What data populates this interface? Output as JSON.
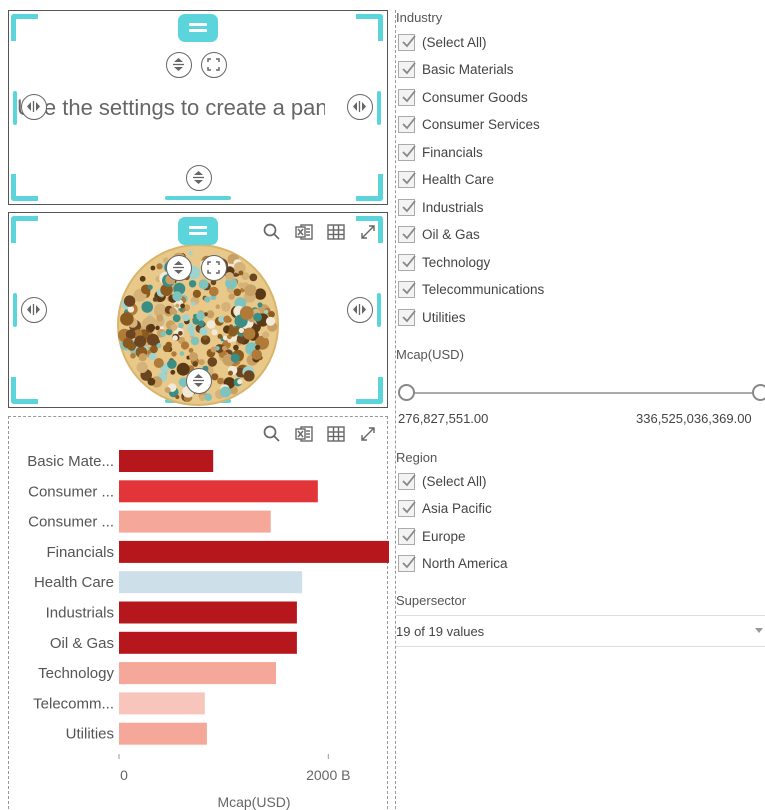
{
  "text_panel": {
    "placeholder": "Use the settings to create a panel"
  },
  "industry_filter": {
    "title": "Industry",
    "items": [
      {
        "label": "(Select All)",
        "checked": true
      },
      {
        "label": "Basic Materials",
        "checked": true
      },
      {
        "label": "Consumer Goods",
        "checked": true
      },
      {
        "label": "Consumer Services",
        "checked": true
      },
      {
        "label": "Financials",
        "checked": true
      },
      {
        "label": "Health Care",
        "checked": true
      },
      {
        "label": "Industrials",
        "checked": true
      },
      {
        "label": "Oil & Gas",
        "checked": true
      },
      {
        "label": "Technology",
        "checked": true
      },
      {
        "label": "Telecommunications",
        "checked": true
      },
      {
        "label": "Utilities",
        "checked": true
      }
    ]
  },
  "mcap_filter": {
    "title": "Mcap(USD)",
    "min_value": "276,827,551.00",
    "max_value": "336,525,036,369.00"
  },
  "region_filter": {
    "title": "Region",
    "items": [
      {
        "label": "(Select All)",
        "checked": true
      },
      {
        "label": "Asia Pacific",
        "checked": true
      },
      {
        "label": "Europe",
        "checked": true
      },
      {
        "label": "North America",
        "checked": true
      }
    ]
  },
  "supersector_filter": {
    "title": "Supersector",
    "selected": "19 of 19 values"
  },
  "colors": {
    "accent": "#5cd4dc",
    "dark_red": "#b5171c",
    "red": "#e2353a",
    "salmon": "#f5a899",
    "light_salmon": "#f7c5bc",
    "light_blue": "#cddfe9"
  },
  "icons": [
    "search-icon",
    "excel-export-icon",
    "table-icon",
    "expand-icon",
    "drag-handle-icon",
    "resize-vertical-icon",
    "resize-horizontal-icon",
    "fullscreen-icon"
  ],
  "chart_data": {
    "type": "bar",
    "orientation": "horizontal",
    "categories": [
      "Basic Mate...",
      "Consumer ...",
      "Consumer ...",
      "Financials",
      "Health Care",
      "Industrials",
      "Oil & Gas",
      "Technology",
      "Telecomm...",
      "Utilities"
    ],
    "values": [
      900,
      1900,
      1450,
      2580,
      1750,
      1700,
      1700,
      1500,
      820,
      840
    ],
    "colors": [
      "#b5171c",
      "#e2353a",
      "#f5a899",
      "#b5171c",
      "#cddfe9",
      "#b5171c",
      "#b5171c",
      "#f5a899",
      "#f7c5bc",
      "#f5a899"
    ],
    "xlabel": "Mcap(USD)",
    "ylabel": "",
    "xticks": [
      "0",
      "2000 B"
    ],
    "xlim": [
      0,
      2580
    ]
  }
}
